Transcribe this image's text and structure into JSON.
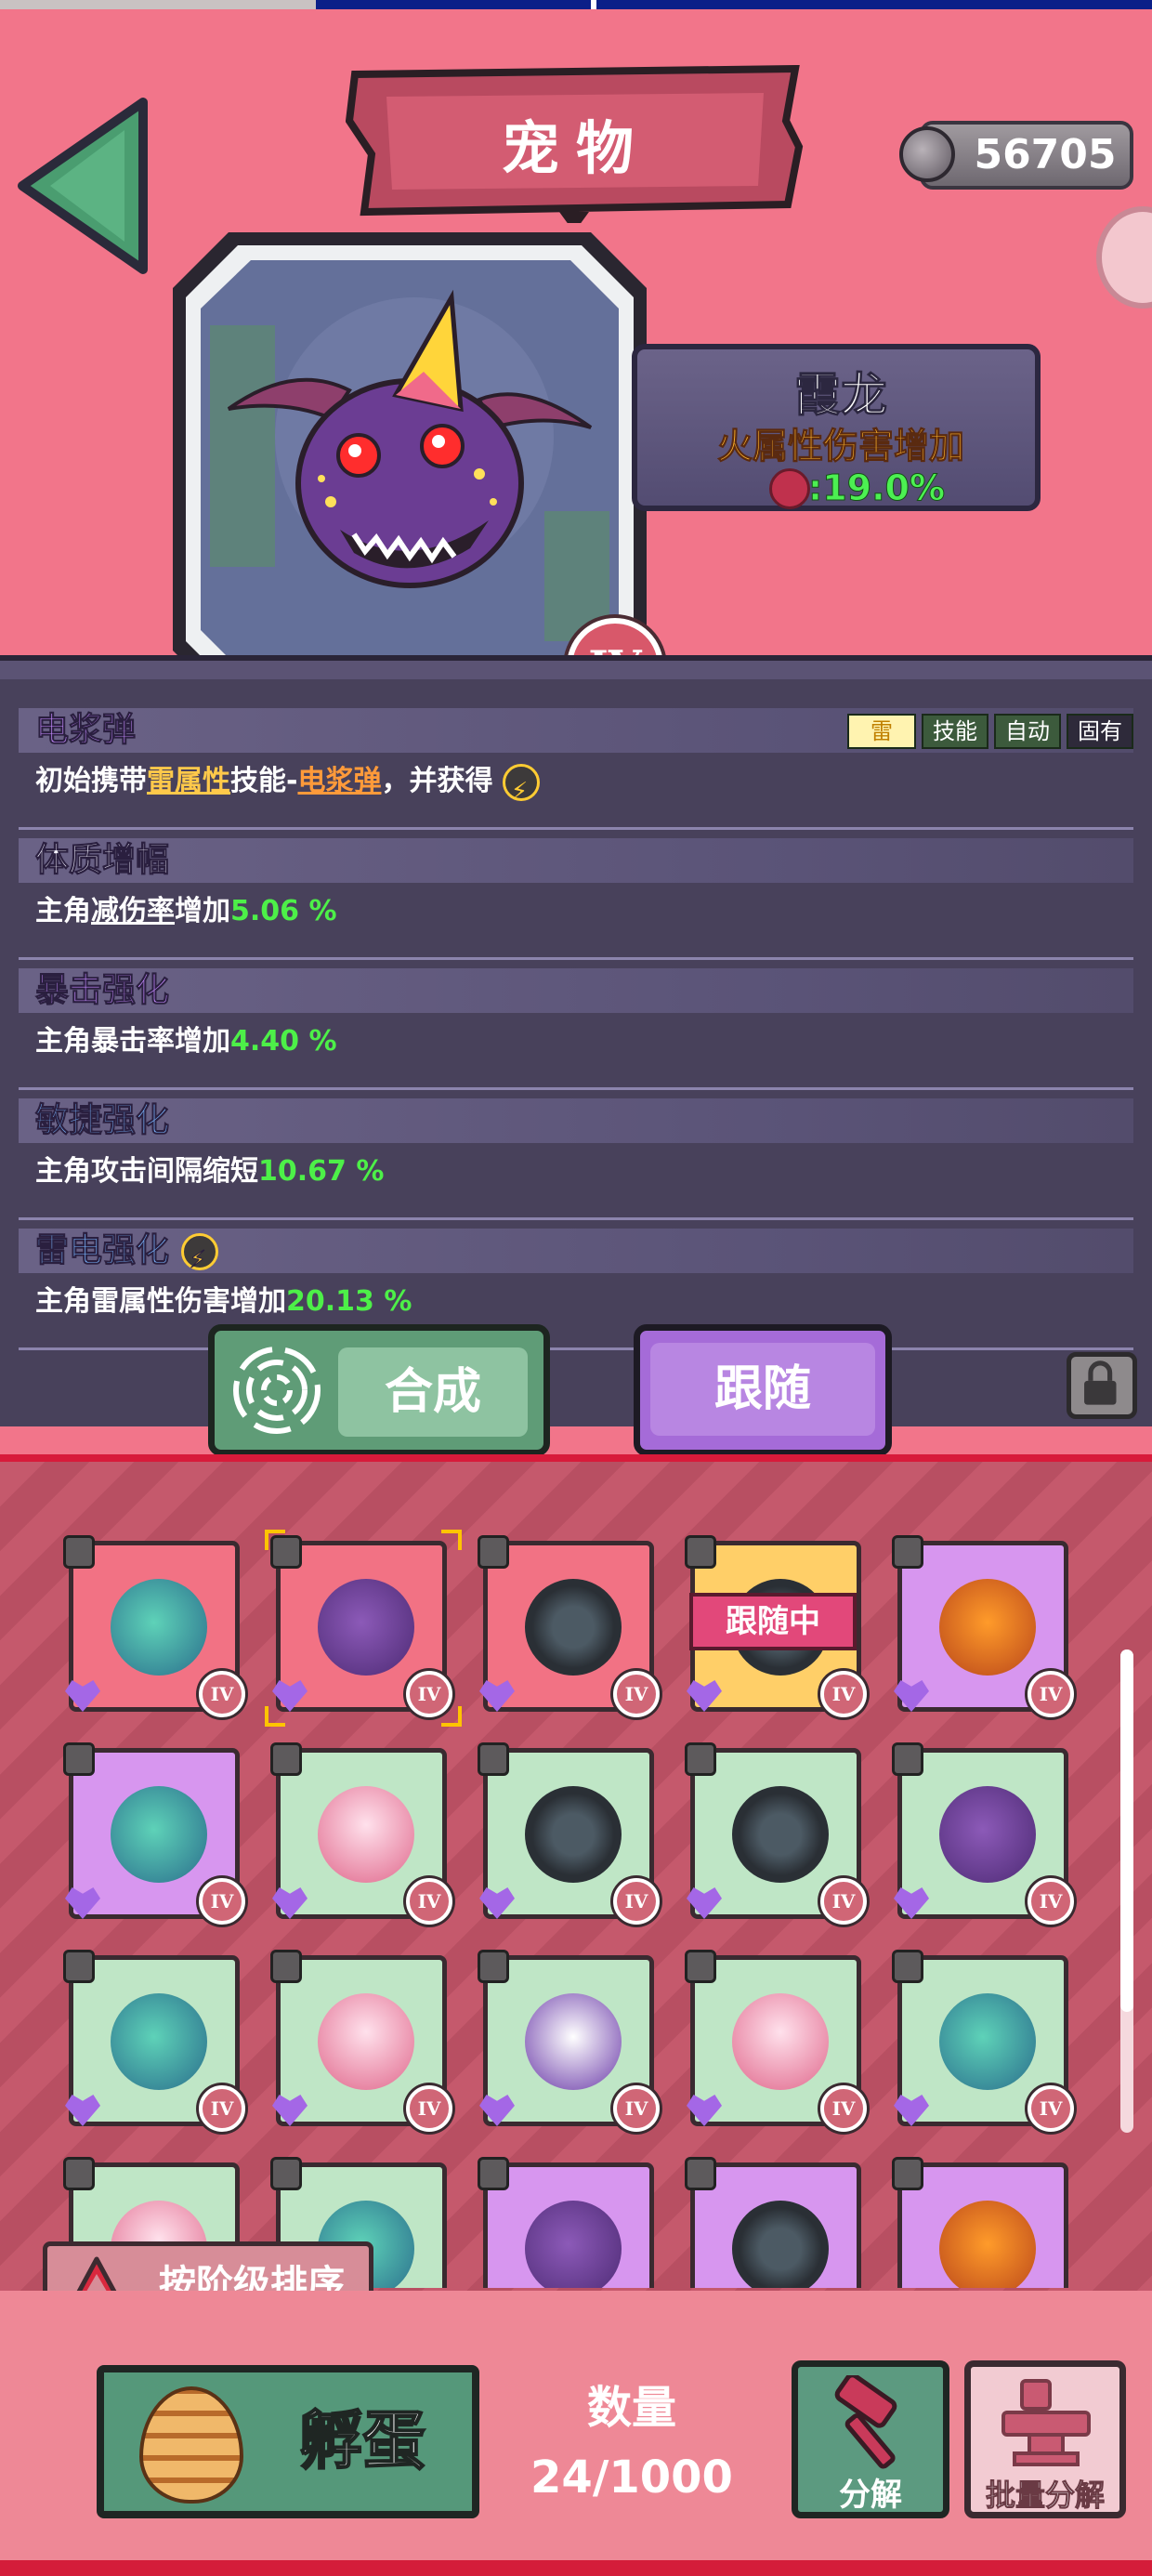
{
  "header": {
    "title": "宠物",
    "currency": "56705",
    "back_icon": "back-arrow-icon",
    "currency_icon": "gear-coin-icon"
  },
  "pet": {
    "name": "霞龙",
    "attribute": "火属性伤害增加",
    "attribute_value": ":19.0%",
    "tier": "IV",
    "attribute_icon": "fire-icon"
  },
  "skills": [
    {
      "title": "电浆弹",
      "desc_parts": [
        "初始携带",
        "雷属性",
        "技能-",
        "电浆弹",
        "，并获得"
      ],
      "tags": [
        "雷",
        "技能",
        "自动",
        "固有"
      ]
    },
    {
      "title": "体质增幅",
      "desc_prefix": "主角",
      "desc_key": "减伤率",
      "desc_mid": "增加",
      "value": "5.06 %"
    },
    {
      "title": "暴击强化",
      "desc_prefix": "主角暴击率增加",
      "value": "4.40 %"
    },
    {
      "title": "敏捷强化",
      "desc_prefix": "主角攻击间隔缩短",
      "value": "10.67 %"
    },
    {
      "title": "雷电强化",
      "desc_prefix": "主角雷属性伤害增加",
      "value": "20.13 %"
    }
  ],
  "actions": {
    "merge": "合成",
    "follow": "跟随"
  },
  "inventory": {
    "following_label": "跟随中",
    "tier_label": "IV",
    "sort_label": "按阶级排序",
    "items": [
      {
        "monster": "ice-totem",
        "bg": "red"
      },
      {
        "monster": "purple-dragon",
        "bg": "red",
        "selected": true
      },
      {
        "monster": "mech-spider",
        "bg": "red"
      },
      {
        "monster": "mech-spider",
        "bg": "orange",
        "following": true
      },
      {
        "monster": "pumpkin-spider",
        "bg": "purple"
      },
      {
        "monster": "ice-totem",
        "bg": "purple"
      },
      {
        "monster": "flower-fairy",
        "bg": "green"
      },
      {
        "monster": "mech-spider",
        "bg": "green"
      },
      {
        "monster": "mech-spider",
        "bg": "green"
      },
      {
        "monster": "purple-dragon",
        "bg": "green"
      },
      {
        "monster": "ice-totem",
        "bg": "green"
      },
      {
        "monster": "flower-fairy",
        "bg": "green"
      },
      {
        "monster": "skull-ghost",
        "bg": "green"
      },
      {
        "monster": "flower-fairy",
        "bg": "green"
      },
      {
        "monster": "ice-totem",
        "bg": "green"
      },
      {
        "monster": "flower-fairy",
        "bg": "green"
      },
      {
        "monster": "ice-totem",
        "bg": "green"
      },
      {
        "monster": "purple-dragon",
        "bg": "purple"
      },
      {
        "monster": "mech-spider",
        "bg": "purple"
      },
      {
        "monster": "pumpkin-spider",
        "bg": "purple"
      }
    ]
  },
  "bottom": {
    "hatch": "孵蛋",
    "count_label": "数量",
    "count_value": "24/1000",
    "decompose": "分解",
    "batch_decompose": "批量分解"
  },
  "colors": {
    "background": "#f2758a",
    "panel": "#48415b",
    "green_value": "#4df048",
    "skill_purple": "#c58bff",
    "skill_blue": "#7ab6ff",
    "merge_button": "#5f9c77",
    "follow_button": "#a56bd8"
  }
}
